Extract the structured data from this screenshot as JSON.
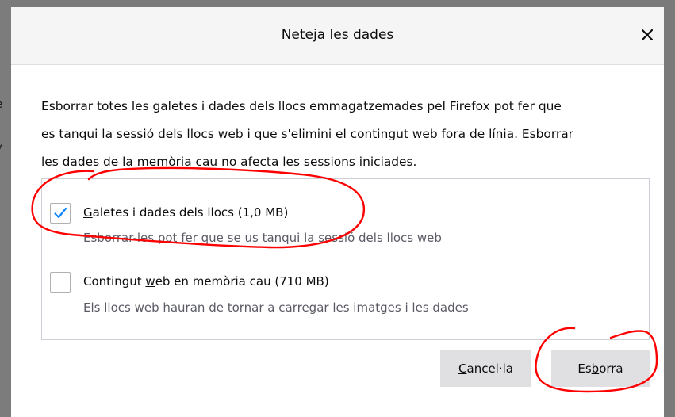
{
  "background": {
    "fragments": [
      "e",
      "y",
      "’"
    ]
  },
  "dialog": {
    "title": "Neteja les dades",
    "close_glyph": "✕",
    "intro_lines": [
      "Esborrar totes les galetes i dades dels llocs emmagatzemades pel Firefox pot fer que",
      "es tanqui la sessió dels llocs web i que s'elimini el contingut web fora de línia. Esborrar",
      "les dades de la memòria cau no afecta les sessions iniciades."
    ],
    "options": [
      {
        "label_access": "G",
        "label_rest": "aletes i dades dels llocs (1,0 MB)",
        "description": "Esborrar-les pot fer que se us tanqui la sessió dels llocs web",
        "checked": true
      },
      {
        "label_pre": "Contingut ",
        "label_access": "w",
        "label_rest": "eb en memòria cau (710 MB)",
        "description": "Els llocs web hauran de tornar a carregar les imatges i les dades",
        "checked": false
      }
    ],
    "buttons": {
      "cancel_access": "C",
      "cancel_rest": "ancel·la",
      "clear_pre": "Es",
      "clear_access": "b",
      "clear_rest": "orra"
    }
  },
  "colors": {
    "accent": "#0a84ff",
    "annotation": "#ff0000",
    "button_bg": "#e0e0e2"
  }
}
